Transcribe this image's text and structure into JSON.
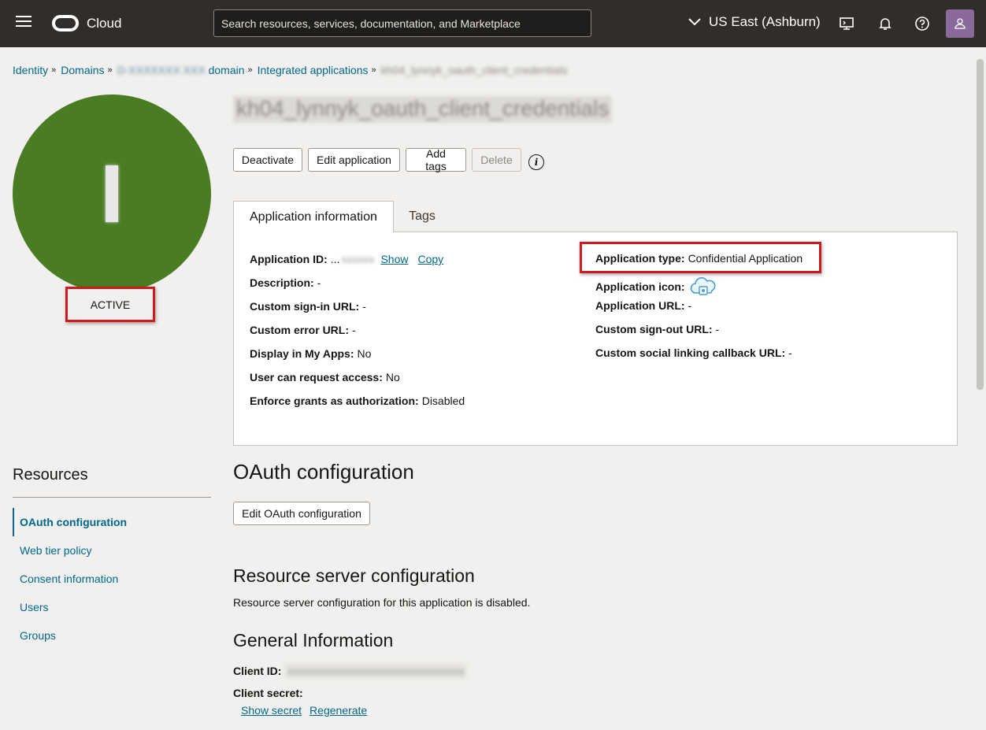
{
  "topbar": {
    "logo_text": "Cloud",
    "search_placeholder": "Search resources, services, documentation, and Marketplace",
    "region": "US East (Ashburn)"
  },
  "breadcrumb": {
    "identity": "Identity",
    "domains": "Domains",
    "domain_name": "D-XXXXXXX XXX",
    "domain_suffix": "domain",
    "integrated_apps": "Integrated applications",
    "current": "kh04_lynnyk_oauth_client_credentials"
  },
  "app": {
    "title": "kh04_lynnyk_oauth_client_credentials",
    "status": "ACTIVE"
  },
  "actions": {
    "deactivate": "Deactivate",
    "edit_application": "Edit application",
    "add_tags": "Add tags",
    "delete": "Delete"
  },
  "tabs": {
    "application_information": "Application information",
    "tags": "Tags"
  },
  "info_left": {
    "app_id_label": "Application ID:",
    "app_id_value": "...",
    "app_id_masked": "xxxxxx",
    "show": "Show",
    "copy": "Copy",
    "description_label": "Description:",
    "description_value": "-",
    "custom_signin_label": "Custom sign-in URL:",
    "custom_signin_value": "-",
    "custom_error_label": "Custom error URL:",
    "custom_error_value": "-",
    "display_myapps_label": "Display in My Apps:",
    "display_myapps_value": "No",
    "user_request_label": "User can request access:",
    "user_request_value": "No",
    "enforce_grants_label": "Enforce grants as authorization:",
    "enforce_grants_value": "Disabled"
  },
  "info_right": {
    "app_type_label": "Application type:",
    "app_type_value": "Confidential Application",
    "app_icon_label": "Application icon:",
    "app_url_label": "Application URL:",
    "app_url_value": "-",
    "custom_signout_label": "Custom sign-out URL:",
    "custom_signout_value": "-",
    "social_callback_label": "Custom social linking callback URL:",
    "social_callback_value": "-"
  },
  "resources": {
    "heading": "Resources",
    "items": [
      "OAuth configuration",
      "Web tier policy",
      "Consent information",
      "Users",
      "Groups"
    ]
  },
  "oauth": {
    "heading": "OAuth configuration",
    "edit_button": "Edit OAuth configuration"
  },
  "resource_server": {
    "heading": "Resource server configuration",
    "text": "Resource server configuration for this application is disabled."
  },
  "general": {
    "heading": "General Information",
    "client_id_label": "Client ID:",
    "client_id_value": "xxxxxxxxxxxxxxxxxxxxxxxxxxxxxxxx",
    "client_secret_label": "Client secret:",
    "show_secret": "Show secret",
    "regenerate": "Regenerate"
  },
  "colors": {
    "topbar": "#312d2a",
    "link": "#00688c",
    "status_green": "#4a7c23",
    "highlight_red": "#d0191b"
  }
}
